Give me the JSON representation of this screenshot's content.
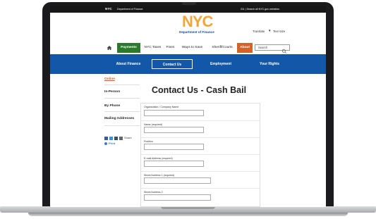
{
  "topbar": {
    "logo": "NYC",
    "department": "Department of Finance",
    "right_text": "311 | Search all NYC.gov websites"
  },
  "header": {
    "logo_text": "NYC",
    "logo_subtitle": "Department of Finance",
    "translate_label": "Translate",
    "text_size_label": "Text-Size"
  },
  "nav": {
    "items": [
      "Payments",
      "NYC Taxes",
      "Fines",
      "Ways to Save",
      "Sheriff/Courts",
      "About"
    ],
    "search_placeholder": "Search"
  },
  "subnav": {
    "items": [
      "About Finance",
      "Contact Us",
      "Employment",
      "Your Rights"
    ]
  },
  "sidebar": {
    "items": [
      "Online",
      "In-Person",
      "By Phone",
      "Mailing Addresses"
    ],
    "share_label": "Share",
    "print_label": "Print"
  },
  "main": {
    "title": "Contact Us - Cash Bail",
    "fields": [
      {
        "label": "Organization / Company Name",
        "value": ""
      },
      {
        "label": "Name (required)",
        "value": ""
      },
      {
        "label": "Position",
        "value": ""
      },
      {
        "label": "E-mail Address (required)",
        "value": ""
      },
      {
        "label": "Street Address 1 (required)",
        "value": ""
      },
      {
        "label": "Street Address 2",
        "value": ""
      }
    ]
  },
  "colors": {
    "nav_payments": "#2b7a2b",
    "nav_about": "#d2642a",
    "subnav_bg": "#1358a8",
    "logo": "#f2a63a",
    "active_sidebar": "#e05a1a"
  }
}
